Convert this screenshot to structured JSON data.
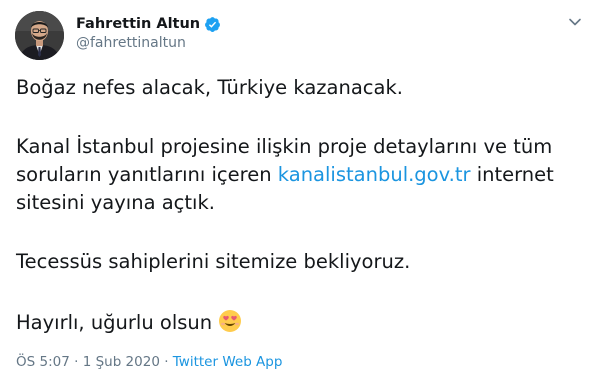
{
  "author": {
    "display_name": "Fahrettin Altun",
    "handle": "@fahrettinaltun",
    "verified": true
  },
  "tweet": {
    "line1": "Boğaz nefes alacak, Türkiye kazanacak.",
    "para2_line1": "Kanal İstanbul projesine ilişkin proje detaylarını ve tüm",
    "para2_line2_prefix": "soruların yanıtlarını içeren ",
    "link_text": "kanalistanbul.gov.tr",
    "para2_line2_suffix": " internet",
    "para2_line3": "sitesini yayına açtık.",
    "line3": "Tecessüs sahiplerini sitemize bekliyoruz.",
    "line4": "Hayırlı, uğurlu olsun",
    "emoji": "smiling-face-with-heart-eyes"
  },
  "meta": {
    "time": "ÖS 5:07",
    "separator": " · ",
    "date": "1 Şub 2020",
    "separator2": " · ",
    "source": "Twitter Web App"
  },
  "colors": {
    "link": "#1b95e0",
    "verified": "#1da1f2",
    "muted": "#657786",
    "text": "#14171a"
  }
}
